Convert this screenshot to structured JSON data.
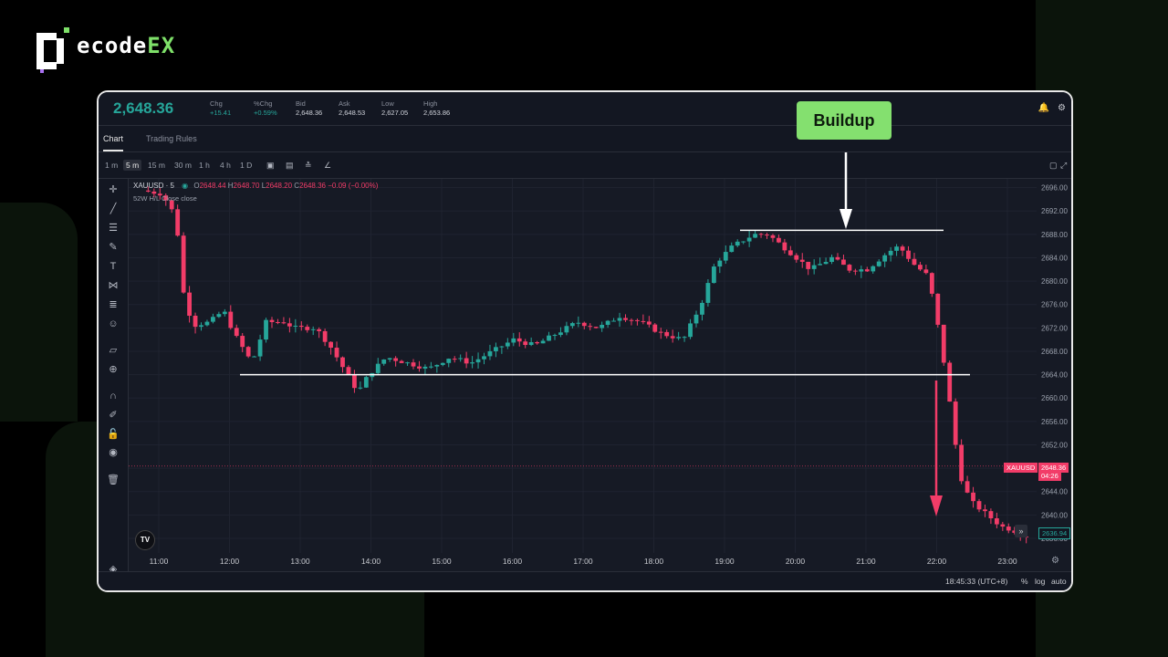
{
  "brand": {
    "logo_letter": "D",
    "name_main": "ecode",
    "name_accent": "EX",
    "accent_color": "#7ee069"
  },
  "quote": {
    "last_price": "2,648.36",
    "fields": [
      {
        "label": "Chg",
        "value": "+15.41",
        "positive": true
      },
      {
        "label": "%Chg",
        "value": "+0.59%",
        "positive": true
      },
      {
        "label": "Bid",
        "value": "2,648.36",
        "positive": false
      },
      {
        "label": "Ask",
        "value": "2,648.53",
        "positive": false
      },
      {
        "label": "Low",
        "value": "2,627.05",
        "positive": false
      },
      {
        "label": "High",
        "value": "2,653.86",
        "positive": false
      }
    ]
  },
  "tabs": [
    {
      "label": "Chart",
      "active": true
    },
    {
      "label": "Trading Rules",
      "active": false
    }
  ],
  "timeframes": [
    {
      "label": "1 m",
      "active": false
    },
    {
      "label": "5 m",
      "active": true
    },
    {
      "label": "15 m",
      "active": false
    },
    {
      "label": "30 m",
      "active": false
    },
    {
      "label": "1 h",
      "active": false
    },
    {
      "label": "4 h",
      "active": false
    },
    {
      "label": "1 D",
      "active": false
    }
  ],
  "toolbar_icons": [
    "indicator-icon",
    "template-icon",
    "compare-icon",
    "draw-icon"
  ],
  "sidebar_icons": [
    "crosshair-icon",
    "trendline-icon",
    "fib-icon",
    "brush-icon",
    "text-icon",
    "pattern-icon",
    "measure-lines-icon",
    "emoji-icon",
    "ruler-icon",
    "zoom-icon",
    "magnet-icon",
    "lock-draw-icon",
    "lock-icon",
    "eye-icon",
    "trash-icon"
  ],
  "legend": {
    "symbol": "XAUUSD · 5",
    "o_label": "O",
    "o": "2648.44",
    "h_label": "H",
    "h": "2648.70",
    "l_label": "L",
    "l": "2648.20",
    "c_label": "C",
    "c": "2648.36",
    "change": "−0.09 (−0.00%)",
    "indicator": "52W H/L Close close"
  },
  "annotation": {
    "label": "Buildup"
  },
  "price_labels": {
    "symbol_tag": "XAUUSD",
    "last": "2648.36",
    "countdown": "04:26",
    "low_marker": "2636.94"
  },
  "bottom": {
    "time": "18:45:33 (UTC+8)",
    "percent": "%",
    "log": "log",
    "auto": "auto"
  },
  "tv_badge": "TV",
  "chart_data": {
    "type": "candlestick",
    "title": "",
    "y_ticks": [
      2696.0,
      2692.0,
      2688.0,
      2684.0,
      2680.0,
      2676.0,
      2672.0,
      2668.0,
      2664.0,
      2660.0,
      2656.0,
      2652.0,
      2648.0,
      2644.0,
      2640.0,
      2636.0
    ],
    "x_ticks": [
      "11:00",
      "12:00",
      "13:00",
      "14:00",
      "15:00",
      "16:00",
      "17:00",
      "18:00",
      "19:00",
      "20:00",
      "21:00",
      "22:00",
      "23:00"
    ],
    "ylim": [
      2633.5,
      2697.5
    ],
    "support_level": 2664.0,
    "buildup_level": 2688.7,
    "last_price": 2648.36,
    "colors": {
      "up": "#26a69a",
      "down": "#f23c68"
    },
    "anchors": [
      [
        10.85,
        2695.5
      ],
      [
        11.1,
        2695
      ],
      [
        11.25,
        2693
      ],
      [
        11.35,
        2688
      ],
      [
        11.45,
        2676
      ],
      [
        11.6,
        2672.5
      ],
      [
        11.8,
        2673
      ],
      [
        12.0,
        2675
      ],
      [
        12.15,
        2671
      ],
      [
        12.4,
        2666
      ],
      [
        12.6,
        2673
      ],
      [
        12.85,
        2673
      ],
      [
        13.0,
        2672
      ],
      [
        13.3,
        2672
      ],
      [
        13.5,
        2669
      ],
      [
        13.75,
        2664
      ],
      [
        13.9,
        2661
      ],
      [
        14.05,
        2664
      ],
      [
        14.3,
        2667
      ],
      [
        14.6,
        2666
      ],
      [
        14.9,
        2665
      ],
      [
        15.2,
        2667
      ],
      [
        15.5,
        2666
      ],
      [
        15.8,
        2668
      ],
      [
        16.1,
        2670
      ],
      [
        16.4,
        2669
      ],
      [
        16.7,
        2671
      ],
      [
        17.0,
        2673
      ],
      [
        17.3,
        2672
      ],
      [
        17.6,
        2674
      ],
      [
        17.9,
        2673
      ],
      [
        18.2,
        2671
      ],
      [
        18.5,
        2670
      ],
      [
        18.75,
        2676
      ],
      [
        18.95,
        2683
      ],
      [
        19.2,
        2686
      ],
      [
        19.5,
        2688
      ],
      [
        19.7,
        2688
      ],
      [
        19.9,
        2686
      ],
      [
        20.1,
        2684
      ],
      [
        20.3,
        2682
      ],
      [
        20.6,
        2684
      ],
      [
        20.85,
        2682
      ],
      [
        21.1,
        2682
      ],
      [
        21.4,
        2685
      ],
      [
        21.55,
        2686
      ],
      [
        21.75,
        2683
      ],
      [
        21.95,
        2681
      ],
      [
        22.05,
        2676
      ],
      [
        22.2,
        2665
      ],
      [
        22.35,
        2652
      ],
      [
        22.45,
        2645
      ],
      [
        22.6,
        2642
      ],
      [
        22.8,
        2640
      ],
      [
        23.0,
        2638
      ],
      [
        23.15,
        2637.5
      ],
      [
        23.3,
        2636.5
      ]
    ]
  }
}
